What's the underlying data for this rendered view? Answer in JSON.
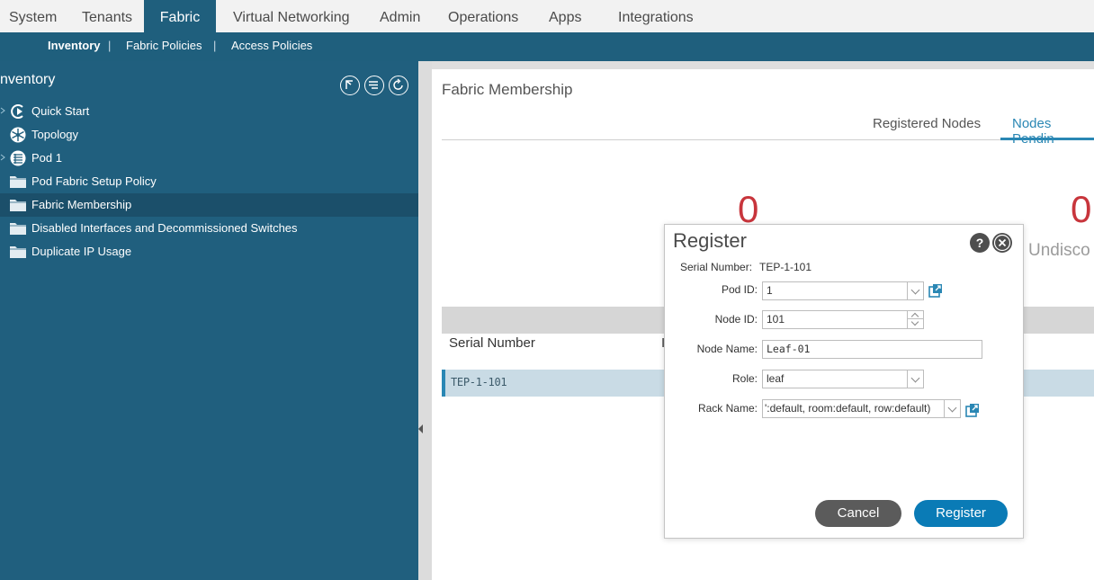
{
  "top_nav": {
    "tabs": [
      {
        "label": "System"
      },
      {
        "label": "Tenants"
      },
      {
        "label": "Fabric"
      },
      {
        "label": "Virtual Networking"
      },
      {
        "label": "Admin"
      },
      {
        "label": "Operations"
      },
      {
        "label": "Apps"
      },
      {
        "label": "Integrations"
      }
    ],
    "active": "Fabric"
  },
  "sub_nav": {
    "items": [
      {
        "label": "Inventory"
      },
      {
        "label": "Fabric Policies"
      },
      {
        "label": "Access Policies"
      }
    ],
    "separator": "|",
    "active": "Inventory"
  },
  "sidebar": {
    "title": "nventory",
    "tree": [
      {
        "label": "Quick Start",
        "icon": "quick-start-icon",
        "expandable": true
      },
      {
        "label": "Topology",
        "icon": "topology-icon",
        "expandable": false
      },
      {
        "label": "Pod 1",
        "icon": "pod-icon",
        "expandable": true
      },
      {
        "label": "Pod Fabric Setup Policy",
        "icon": "folder-icon",
        "expandable": false
      },
      {
        "label": "Fabric Membership",
        "icon": "folder-icon",
        "expandable": false
      },
      {
        "label": "Disabled Interfaces and Decommissioned Switches",
        "icon": "folder-icon",
        "expandable": false
      },
      {
        "label": "Duplicate IP Usage",
        "icon": "folder-icon",
        "expandable": false
      }
    ],
    "selected": "Fabric Membership"
  },
  "main": {
    "title": "Fabric Membership",
    "tabs": [
      {
        "label": "Registered Nodes"
      },
      {
        "label": "Nodes Pendin"
      }
    ],
    "active_tab": "Nodes Pendin",
    "stats": [
      {
        "value": "0"
      },
      {
        "value": "0",
        "label": "Undisco"
      }
    ],
    "table": {
      "columns": [
        "Serial Number",
        "I"
      ],
      "rows": [
        {
          "serial": "TEP-1-101"
        }
      ]
    }
  },
  "modal": {
    "title": "Register",
    "serial_label": "Serial Number:",
    "serial_value": "TEP-1-101",
    "pod_id_label": "Pod ID:",
    "pod_id_value": "1",
    "node_id_label": "Node ID:",
    "node_id_value": "101",
    "node_name_label": "Node Name:",
    "node_name_value": "Leaf-01",
    "role_label": "Role:",
    "role_value": "leaf",
    "rack_name_label": "Rack Name:",
    "rack_name_value": "':default, room:default, row:default)",
    "cancel_label": "Cancel",
    "register_label": "Register",
    "help_glyph": "?",
    "accent_color": "#0a7bb6"
  }
}
